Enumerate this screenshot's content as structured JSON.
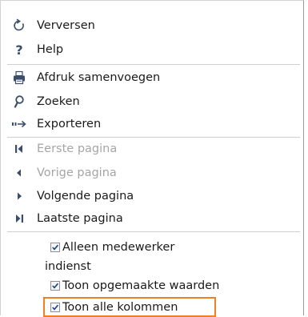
{
  "menu": {
    "items": [
      {
        "label": "Verversen",
        "icon": "refresh-icon",
        "enabled": true
      },
      {
        "label": "Help",
        "icon": "question-mark-icon",
        "enabled": true
      },
      {
        "label": "Afdruk samenvoegen",
        "icon": "printer-icon",
        "enabled": true
      },
      {
        "label": "Zoeken",
        "icon": "search-icon",
        "enabled": true
      },
      {
        "label": "Exporteren",
        "icon": "export-arrow-icon",
        "enabled": true
      },
      {
        "label": "Eerste pagina",
        "icon": "first-page-icon",
        "enabled": false
      },
      {
        "label": "Vorige pagina",
        "icon": "previous-page-icon",
        "enabled": false
      },
      {
        "label": "Volgende pagina",
        "icon": "next-page-icon",
        "enabled": true
      },
      {
        "label": "Laatste pagina",
        "icon": "last-page-icon",
        "enabled": true
      }
    ],
    "options": {
      "only_employee": {
        "line1": "Alleen medewerker",
        "line2": "indienst",
        "checked": true
      },
      "formatted_values": {
        "label": "Toon opgemaakte waarden",
        "checked": true
      },
      "all_columns": {
        "label": "Toon alle kolommen",
        "checked": true
      }
    }
  },
  "colors": {
    "highlight": "#f07f26",
    "icon": "#3a4e6b",
    "disabled_text": "#a5a5a5"
  }
}
